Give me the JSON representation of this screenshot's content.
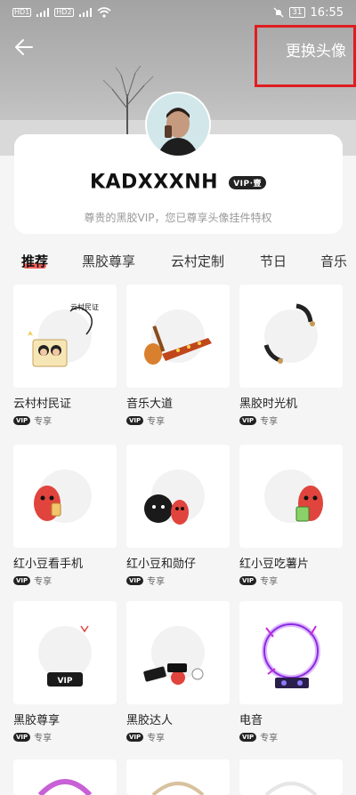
{
  "status_bar": {
    "left": "HD 1 46 HD 2 46",
    "time": "16:55",
    "battery": "31"
  },
  "header": {
    "change_avatar_label": "更换头像"
  },
  "profile": {
    "username": "KADXXXNH",
    "vip_badge": "VIP·壹",
    "description": "尊贵的黑胶VIP，您已尊享头像挂件特权"
  },
  "tabs": [
    "推荐",
    "黑胶尊享",
    "云村定制",
    "节日",
    "音乐"
  ],
  "items": [
    {
      "name": "云村村民证",
      "tag": "专享"
    },
    {
      "name": "音乐大道",
      "tag": "专享"
    },
    {
      "name": "黑胶时光机",
      "tag": "专享"
    },
    {
      "name": "红小豆看手机",
      "tag": "专享"
    },
    {
      "name": "红小豆和勋仔",
      "tag": "专享"
    },
    {
      "name": "红小豆吃薯片",
      "tag": "专享"
    },
    {
      "name": "黑胶尊享",
      "tag": "专享"
    },
    {
      "name": "黑胶达人",
      "tag": "专享"
    },
    {
      "name": "电音",
      "tag": "专享"
    }
  ],
  "badge_text": "VIP"
}
